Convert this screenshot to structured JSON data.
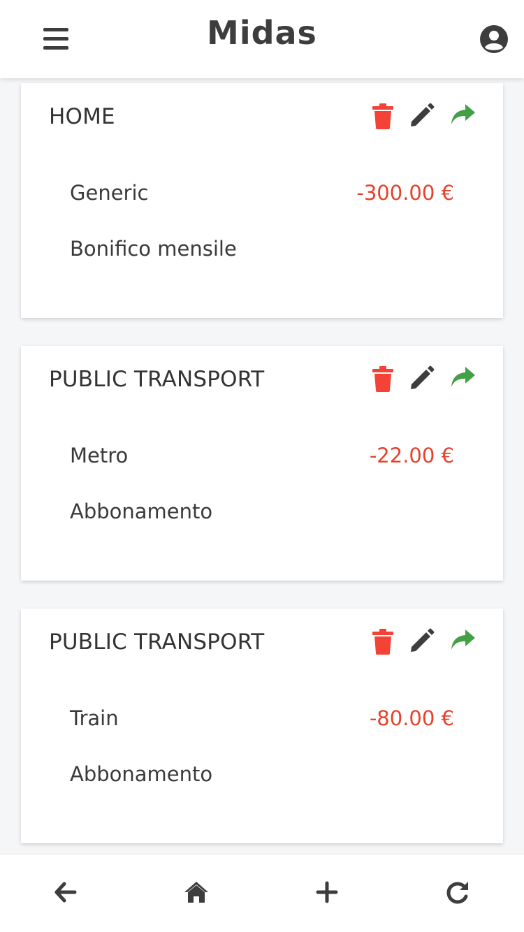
{
  "header": {
    "title": "Midas",
    "menu_icon": "hamburger-menu-icon",
    "profile_icon": "user-circle-icon"
  },
  "colors": {
    "expense": "#e5432d",
    "delete": "#f44336",
    "edit": "#3d3d3d",
    "share": "#43a047",
    "text": "#3a3a3a"
  },
  "transactions": [
    {
      "title": "HOME",
      "category": "Generic",
      "amount": "-300.00 €",
      "description": "Bonifico mensile"
    },
    {
      "title": "PUBLIC TRANSPORT",
      "category": "Metro",
      "amount": "-22.00 €",
      "description": "Abbonamento"
    },
    {
      "title": "PUBLIC TRANSPORT",
      "category": "Train",
      "amount": "-80.00 €",
      "description": "Abbonamento"
    }
  ],
  "card_actions": [
    "trash-icon",
    "pencil-icon",
    "share-icon"
  ],
  "bottom_nav": [
    "arrow-left-icon",
    "home-icon",
    "plus-icon",
    "refresh-icon"
  ]
}
